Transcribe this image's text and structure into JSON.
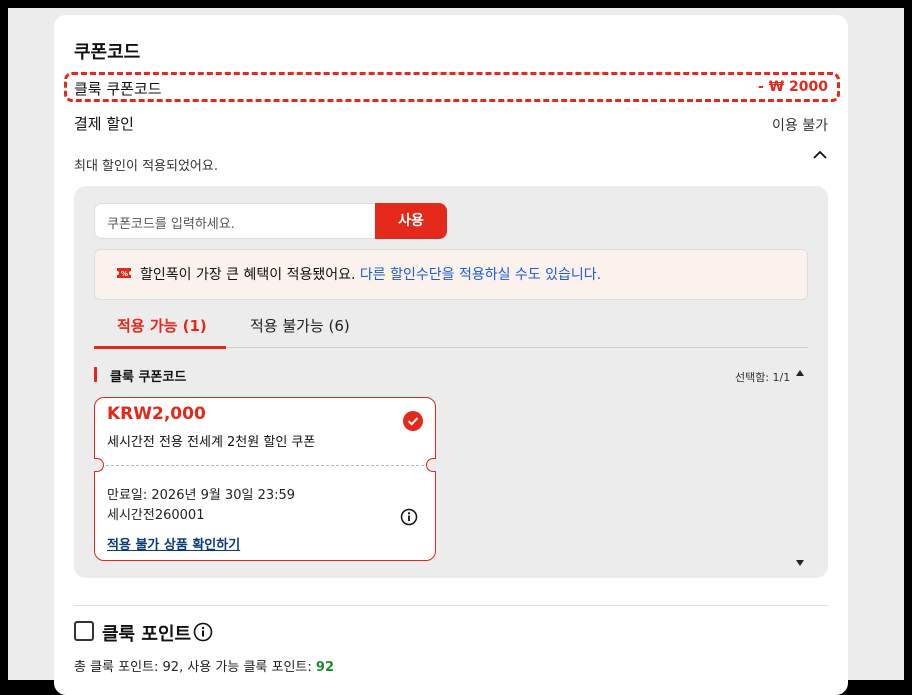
{
  "coupon_code_section": {
    "title": "쿠폰코드",
    "click_coupon_label": "클룩 쿠폰코드",
    "click_coupon_discount": "- ₩ 2000",
    "payment_discount_label": "결제 할인",
    "payment_discount_value": "이용 불가",
    "max_discount_note": "최대 할인이 적용되었어요."
  },
  "input": {
    "placeholder": "쿠폰코드를 입력하세요.",
    "apply_label": "사용"
  },
  "notice": {
    "text": "할인폭이 가장 큰 혜택이 적용됐어요.",
    "link": "다른 할인수단을 적용하실 수도 있습니다."
  },
  "tabs": [
    {
      "label": "적용 가능 (1)",
      "active": true
    },
    {
      "label": "적용 불가능 (6)",
      "active": false
    }
  ],
  "coupon_list": {
    "section_title": "클룩 쿠폰코드",
    "selected_count": "선택함: 1/1"
  },
  "coupon": {
    "amount": "KRW2,000",
    "description": "세시간전 전용 전세계 2천원 할인 쿠폰",
    "expiry": "만료일: 2026년 9월 30일 23:59",
    "code": "세시간전260001",
    "link": "적용 불가 상품 확인하기"
  },
  "points": {
    "title": "클룩 포인트",
    "info_prefix": "총 클룩 포인트: 92, 사용 가능 클룩 포인트: ",
    "available": "92"
  },
  "colors": {
    "accent": "#e4281a",
    "link": "#1a5bd6",
    "points_green": "#1b8a2e"
  },
  "icons": [
    "chevron-up-icon",
    "coupon-ticket-icon",
    "check-circle-icon",
    "info-icon",
    "scroll-up-icon",
    "scroll-down-icon"
  ]
}
